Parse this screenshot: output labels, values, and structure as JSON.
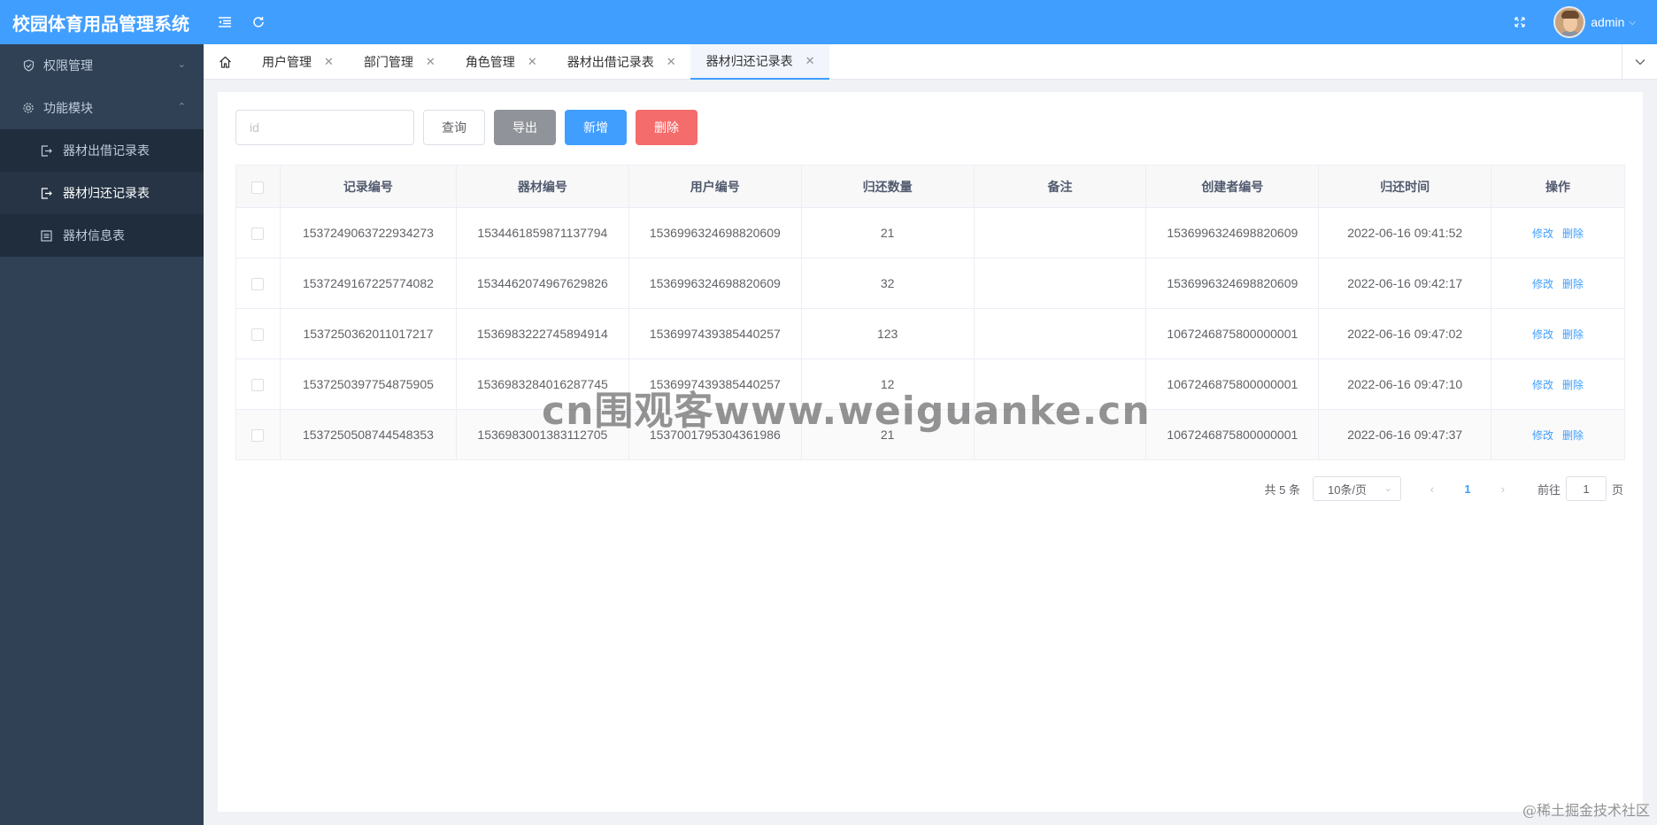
{
  "app": {
    "title": "校园体育用品管理系统"
  },
  "header": {
    "username": "admin"
  },
  "sidebar": {
    "items": [
      {
        "label": "权限管理",
        "icon": "shield-icon",
        "expanded": false
      },
      {
        "label": "功能模块",
        "icon": "gear-icon",
        "expanded": true
      }
    ],
    "subitems": [
      {
        "label": "器材出借记录表",
        "icon": "sign-out-icon"
      },
      {
        "label": "器材归还记录表",
        "icon": "sign-in-icon"
      },
      {
        "label": "器材信息表",
        "icon": "list-icon"
      }
    ]
  },
  "tags": [
    {
      "label": "用户管理"
    },
    {
      "label": "部门管理"
    },
    {
      "label": "角色管理"
    },
    {
      "label": "器材出借记录表"
    },
    {
      "label": "器材归还记录表"
    }
  ],
  "search": {
    "placeholder": "id",
    "value": ""
  },
  "toolbar": {
    "query_label": "查询",
    "export_label": "导出",
    "add_label": "新增",
    "delete_label": "删除"
  },
  "table": {
    "headers": [
      "记录编号",
      "器材编号",
      "用户编号",
      "归还数量",
      "备注",
      "创建者编号",
      "归还时间",
      "操作"
    ],
    "rows": [
      [
        "1537249063722934273",
        "1534461859871137794",
        "1536996324698820609",
        "21",
        "",
        "1536996324698820609",
        "2022-06-16 09:41:52"
      ],
      [
        "1537249167225774082",
        "1534462074967629826",
        "1536996324698820609",
        "32",
        "",
        "1536996324698820609",
        "2022-06-16 09:42:17"
      ],
      [
        "1537250362011017217",
        "1536983222745894914",
        "1536997439385440257",
        "123",
        "",
        "1067246875800000001",
        "2022-06-16 09:47:02"
      ],
      [
        "1537250397754875905",
        "1536983284016287745",
        "1536997439385440257",
        "12",
        "",
        "1067246875800000001",
        "2022-06-16 09:47:10"
      ],
      [
        "1537250508744548353",
        "1536983001383112705",
        "1537001795304361986",
        "21",
        "",
        "1067246875800000001",
        "2022-06-16 09:47:37"
      ]
    ],
    "edit_label": "修改",
    "delete_label": "删除"
  },
  "pagination": {
    "total": "共 5 条",
    "page_size": "10条/页",
    "current": "1",
    "goto_prefix": "前往",
    "goto_value": "1",
    "goto_suffix": "页"
  },
  "watermark": "cn围观客www.weiguanke.cn",
  "corner_mark": "@稀土掘金技术社区",
  "colors": {
    "primary": "#409eff",
    "sidebar": "#304156",
    "submenu": "#1f2d3d",
    "danger": "#f56c6c",
    "info": "#909399"
  }
}
